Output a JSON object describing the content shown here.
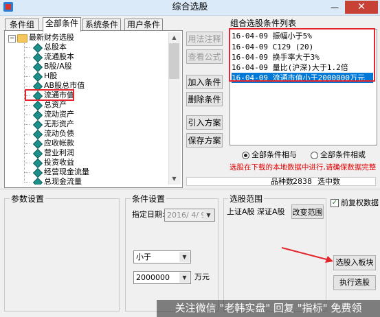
{
  "window": {
    "title": "综合选股",
    "close_symbol": "✕",
    "minimize_symbol": "—"
  },
  "tabs": [
    "条件组",
    "全部条件",
    "系统条件",
    "用户条件"
  ],
  "tree": {
    "root": "最新财务选股",
    "items": [
      "总股本",
      "流通股本",
      "B股/A股",
      "H股",
      "AB股总市值",
      "流通市值",
      "总资产",
      "流动资产",
      "无形资产",
      "流动负债",
      "应收帐款",
      "营业利润",
      "投资收益",
      "经营现金流量",
      "总现金流量"
    ]
  },
  "buttons": {
    "usage": "用法注释",
    "view_formula": "查看公式",
    "add": "加入条件",
    "delete": "删除条件",
    "import": "引入方案",
    "save": "保存方案",
    "change_range": "改变范围",
    "select_into_board": "选股入板块",
    "execute": "执行选股"
  },
  "conditions": {
    "label": "组合选股条件列表",
    "items": [
      "16-04-09 振幅小于5%",
      "16-04-09 C129 (20)",
      "16-04-09 换手率大于3%",
      "16-04-09 量比(沪深)大于1.2倍",
      "16-04-09 流通市值小于2000000万元"
    ],
    "selected_index": 4
  },
  "logic": {
    "and_label": "全部条件相与",
    "or_label": "全部条件相或",
    "selected": "and"
  },
  "warning": "选股在下载的本地数据中进行,请确保数据完整",
  "counts": {
    "total_label": "品种数",
    "total_value": "2838",
    "selected_label": "选中数"
  },
  "params": {
    "label": "参数设置"
  },
  "cond_settings": {
    "label": "条件设置",
    "date_label": "指定日期:",
    "date_value": "2016/ 4/ 9",
    "operator": "小于",
    "value": "2000000",
    "unit": "万元"
  },
  "range": {
    "label": "选股范围",
    "text": "上证A股 深证A股"
  },
  "pre_adjust": {
    "label": "前复权数据",
    "checked": true
  },
  "watermark": "关注微信 \"老韩实盘\" 回复 \"指标\" 免费领",
  "colors": {
    "highlight_red": "#e4252b",
    "selection_blue": "#0078d7",
    "warning_text": "#e60000"
  }
}
